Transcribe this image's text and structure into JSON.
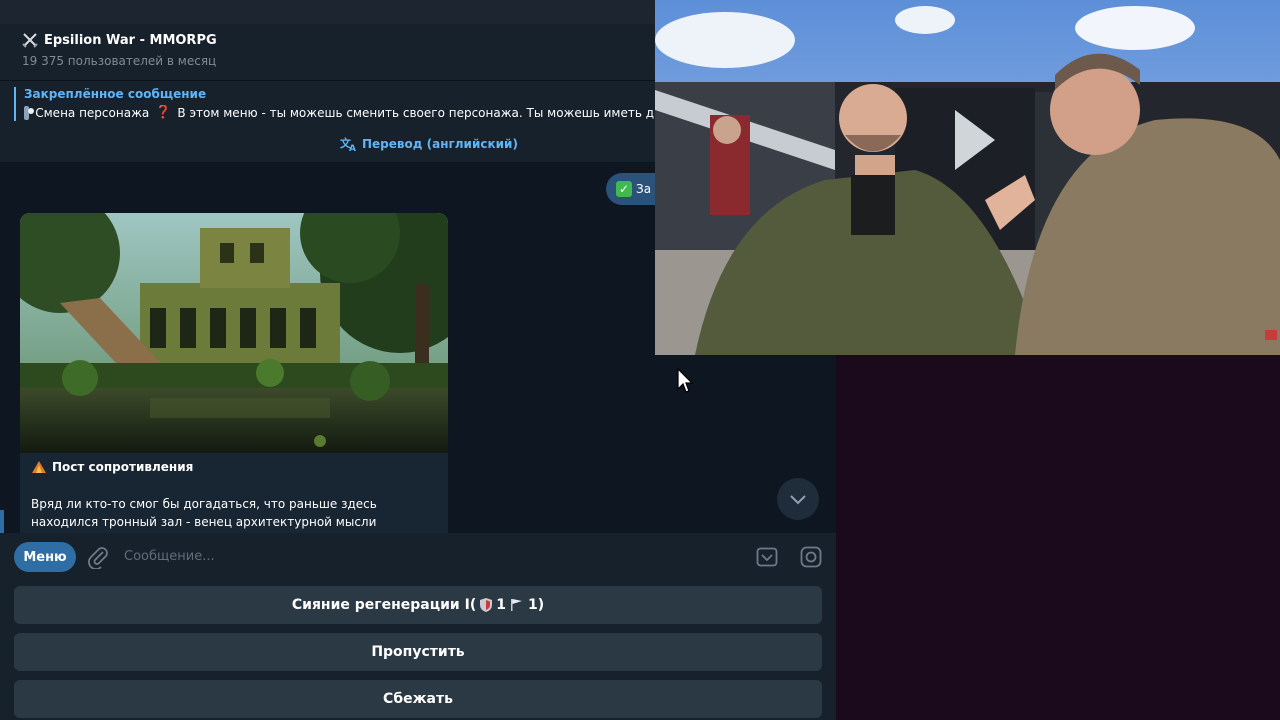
{
  "chat": {
    "title": "Epsilion War - MMORPG",
    "subtitle": "19 375 пользователей в месяц"
  },
  "pinned": {
    "title": "Закреплённое сообщение",
    "label": "Смена персонажа",
    "text": "В этом меню - ты можешь сменить своего персонажа. Ты можешь иметь д"
  },
  "translate": {
    "label": "Перевод (английский)"
  },
  "outgoing": {
    "text": "За"
  },
  "message": {
    "heading": "Пост сопротивления",
    "body": "Вряд ли кто-то смог бы догадаться, что раньше здесь находился тронный зал - венец архитектурной мысли троглодитов. Тьма"
  },
  "composer": {
    "menu_label": "Меню",
    "placeholder": "Сообщение..."
  },
  "keyboard": {
    "buttons": [
      {
        "label": "Сияние регенерации I(",
        "suffix": "1",
        "suffix2": "1)"
      },
      {
        "label": "Пропустить"
      },
      {
        "label": "Сбежать"
      }
    ]
  },
  "colors": {
    "accent": "#5eb5f7",
    "button": "#2b3945",
    "menu": "#2f6ea5"
  }
}
